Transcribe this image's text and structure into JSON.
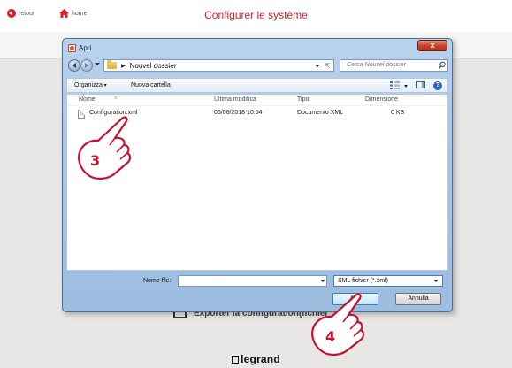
{
  "app": {
    "title": "Configurer le système",
    "back_label": "retour",
    "home_label": "home",
    "export_label": "Exporter la configuration(fichier",
    "brand": "legrand"
  },
  "dialog": {
    "title": "Apri",
    "close_label": "x",
    "address": {
      "crumb": "Nouvel dossier",
      "search_placeholder": "Cerca Nouvel dossier"
    },
    "toolbar": {
      "organize_label": "Organizza",
      "new_folder_label": "Nuova cartella"
    },
    "columns": {
      "name": "Nome",
      "modified": "Ultima modifica",
      "type": "Tipo",
      "size": "Dimensione"
    },
    "files": [
      {
        "name": "Configuration.xml",
        "modified": "06/06/2018 10:54",
        "type": "Documento XML",
        "size": "0 KB"
      }
    ],
    "filename_label": "Nome file:",
    "filename_value": "",
    "filetype": "XML fichier (*.xml)",
    "open_label": "Apri",
    "cancel_label": "Annulla"
  },
  "annotations": {
    "step_a": "3",
    "step_b": "4"
  },
  "colors": {
    "brand_red": "#d2232a",
    "dialog_frame": "#a7c5e6"
  }
}
